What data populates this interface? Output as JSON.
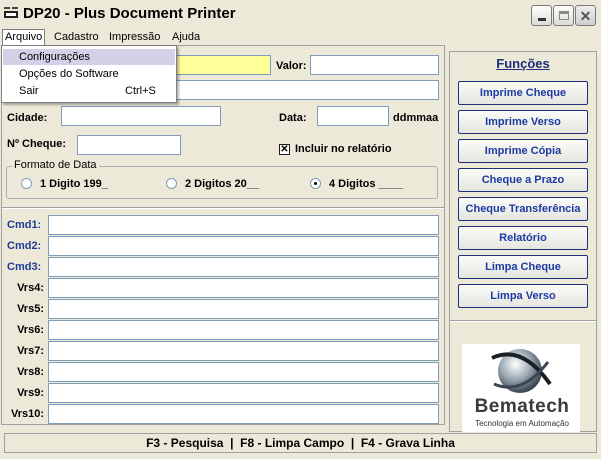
{
  "window": {
    "title": "DP20 - Plus Document Printer",
    "icon_label": "DP20"
  },
  "menu": {
    "items": [
      "Arquivo",
      "Cadastro",
      "Impressão",
      "Ajuda"
    ],
    "dropdown": [
      {
        "label": "Configurações",
        "shortcut": ""
      },
      {
        "label": "Opções do Software",
        "shortcut": ""
      },
      {
        "label": "Sair",
        "shortcut": "Ctrl+S"
      }
    ]
  },
  "form": {
    "valor_label": "Valor:",
    "cidade_label": "Cidade:",
    "data_label": "Data:",
    "data_format": "ddmmaa",
    "cheque_label": "Nº Cheque:",
    "incluir_label": "Incluir no relatório",
    "incluir_checked": true,
    "highlight_color": "#ffff99",
    "formato": {
      "title": "Formato de Data",
      "options": [
        "1 Digito 199_",
        "2 Digitos 20__",
        "4 Digitos ____"
      ],
      "selected_index": 2
    }
  },
  "commands": [
    {
      "label": "Cmd1:",
      "blue": true
    },
    {
      "label": "Cmd2:",
      "blue": true
    },
    {
      "label": "Cmd3:",
      "blue": true
    },
    {
      "label": "Vrs4:",
      "blue": false
    },
    {
      "label": "Vrs5:",
      "blue": false
    },
    {
      "label": "Vrs6:",
      "blue": false
    },
    {
      "label": "Vrs7:",
      "blue": false
    },
    {
      "label": "Vrs8:",
      "blue": false
    },
    {
      "label": "Vrs9:",
      "blue": false
    },
    {
      "label": "Vrs10:",
      "blue": false
    }
  ],
  "functions": {
    "title": "Funções",
    "buttons": [
      "Imprime Cheque",
      "Imprime Verso",
      "Imprime Cópia",
      "Cheque a Prazo",
      "Cheque Transferência",
      "Relatório",
      "Limpa Cheque",
      "Limpa Verso"
    ]
  },
  "logo": {
    "name": "Bematech",
    "tagline": "Tecnologia em Automação"
  },
  "status": {
    "text": "F3 - Pesquisa  |  F8 - Limpa Campo  |  F4 - Grava Linha"
  }
}
